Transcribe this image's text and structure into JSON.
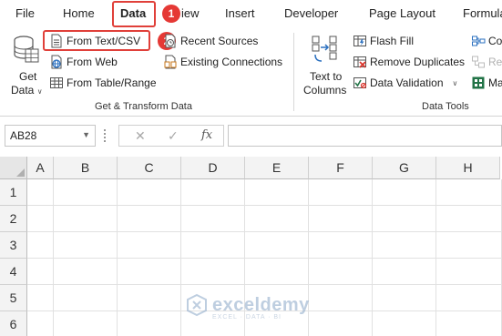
{
  "tabs": [
    {
      "label": "File"
    },
    {
      "label": "Home"
    },
    {
      "label": "Data",
      "active": true
    },
    {
      "label": "View",
      "visible_text": "iew"
    },
    {
      "label": "Insert"
    },
    {
      "label": "Developer"
    },
    {
      "label": "Page Layout"
    },
    {
      "label": "Formula",
      "visible_text": "Formula"
    }
  ],
  "badges": {
    "step1": "1",
    "step2": "2"
  },
  "ribbon": {
    "get_transform": {
      "get_data_line1": "Get",
      "get_data_line2": "Data",
      "from_text_csv": "From Text/CSV",
      "from_web": "From Web",
      "from_table_range": "From Table/Range",
      "recent_sources": "Recent Sources",
      "existing_connections": "Existing Connections",
      "group_label": "Get & Transform Data"
    },
    "data_tools": {
      "text_to_columns_line1": "Text to",
      "text_to_columns_line2": "Columns",
      "flash_fill": "Flash Fill",
      "remove_duplicates": "Remove Duplicates",
      "data_validation": "Data Validation",
      "consolidate_partial": "Co",
      "relationships_partial": "Rel",
      "manage_model_partial": "Ma",
      "group_label": "Data Tools"
    }
  },
  "formula_bar": {
    "name_box": "AB28",
    "cancel_symbol": "✕",
    "enter_symbol": "✓",
    "fx_symbol": "fx",
    "formula": ""
  },
  "grid": {
    "columns": [
      "A",
      "B",
      "C",
      "D",
      "E",
      "F",
      "G",
      "H"
    ],
    "rows": [
      "1",
      "2",
      "3",
      "4",
      "5",
      "6"
    ]
  },
  "watermark": {
    "name": "exceldemy",
    "tagline": "EXCEL · DATA · BI"
  },
  "colors": {
    "highlight": "#e0403a",
    "badge": "#e53935",
    "excel_green": "#217346"
  }
}
